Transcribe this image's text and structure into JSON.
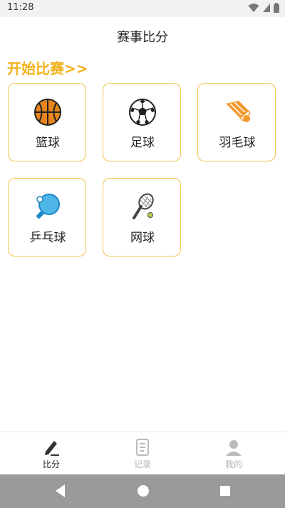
{
  "status_bar": {
    "time": "11:28"
  },
  "header": {
    "title": "赛事比分"
  },
  "start_label": "开始比赛>>",
  "sports": [
    {
      "label": "篮球",
      "icon": "basketball-icon"
    },
    {
      "label": "足球",
      "icon": "soccer-ball-icon"
    },
    {
      "label": "羽毛球",
      "icon": "shuttlecock-icon"
    },
    {
      "label": "乒乓球",
      "icon": "ping-pong-paddle-icon"
    },
    {
      "label": "网球",
      "icon": "tennis-racket-icon"
    }
  ],
  "bottom_nav": [
    {
      "label": "比分",
      "icon": "edit-pen-icon",
      "active": true
    },
    {
      "label": "记录",
      "icon": "notebook-icon",
      "active": false
    },
    {
      "label": "我的",
      "icon": "user-icon",
      "active": false
    }
  ],
  "colors": {
    "accent": "#f2b21a",
    "card_border": "#f3c34f"
  }
}
